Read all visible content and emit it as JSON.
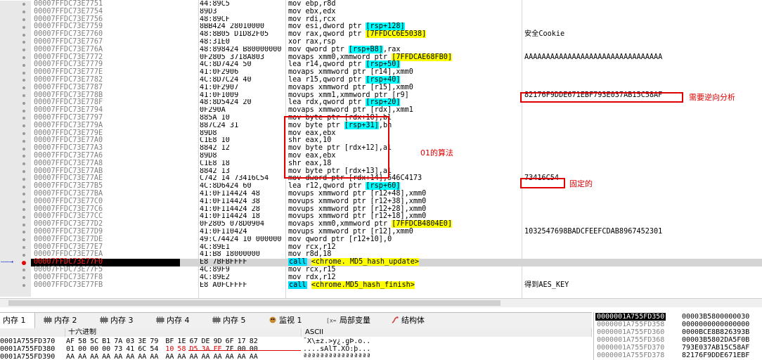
{
  "colors": {
    "accent_red": "#e00000",
    "ptr_yellow": "#ffff00",
    "reg_cyan": "#00ffff",
    "call_cyan": "#00e0ff",
    "arrow_blue": "#1b2bd6"
  },
  "disasm_rows": [
    {
      "addr": "00007FFDC73E7751",
      "bytes": "44:89C5",
      "ins": [
        {
          "t": "mov ebp,r8d"
        }
      ],
      "comment": ""
    },
    {
      "addr": "00007FFDC73E7754",
      "bytes": "89D3",
      "ins": [
        {
          "t": "mov ebx,edx"
        }
      ],
      "comment": ""
    },
    {
      "addr": "00007FFDC73E7756",
      "bytes": "48:89CF",
      "ins": [
        {
          "t": "mov rdi,rcx"
        }
      ],
      "comment": ""
    },
    {
      "addr": "00007FFDC73E7759",
      "bytes": "8BB424 28010000",
      "ins": [
        {
          "t": "mov esi,dword ptr "
        },
        {
          "t": "[rsp+128]",
          "c": "cy"
        }
      ],
      "comment": ""
    },
    {
      "addr": "00007FFDC73E7760",
      "bytes": "48:8B05 D1D82F05",
      "ins": [
        {
          "t": "mov rax,qword ptr "
        },
        {
          "t": "[7FFDCC6E5038]",
          "c": "y"
        }
      ],
      "comment": "安全Cookie"
    },
    {
      "addr": "00007FFDC73E7767",
      "bytes": "48:31E0",
      "ins": [
        {
          "t": "xor rax,rsp"
        }
      ],
      "comment": ""
    },
    {
      "addr": "00007FFDC73E776A",
      "bytes": "48:898424 B80000000",
      "ins": [
        {
          "t": "mov qword ptr "
        },
        {
          "t": "[rsp+B8]",
          "c": "cy"
        },
        {
          "t": ",rax"
        }
      ],
      "comment": ""
    },
    {
      "addr": "00007FFDC73E7772",
      "bytes": "0F2805 3718A803",
      "ins": [
        {
          "t": "movaps xmm0,xmmword ptr "
        },
        {
          "t": "[7FFDCAE68FB0]",
          "c": "y"
        }
      ],
      "comment": "AAAAAAAAAAAAAAAAAAAAAAAAAAAAAAAA"
    },
    {
      "addr": "00007FFDC73E7779",
      "bytes": "4C:8D7424 50",
      "ins": [
        {
          "t": "lea r14,qword ptr "
        },
        {
          "t": "[rsp+50]",
          "c": "cy"
        }
      ],
      "comment": ""
    },
    {
      "addr": "00007FFDC73E777E",
      "bytes": "41:0F2906",
      "ins": [
        {
          "t": "movaps xmmword ptr [r14],xmm0"
        }
      ],
      "comment": ""
    },
    {
      "addr": "00007FFDC73E7782",
      "bytes": "4C:8D7C24 40",
      "ins": [
        {
          "t": "lea r15,qword ptr "
        },
        {
          "t": "[rsp+40]",
          "c": "cy"
        }
      ],
      "comment": ""
    },
    {
      "addr": "00007FFDC73E7787",
      "bytes": "41:0F2907",
      "ins": [
        {
          "t": "movaps xmmword ptr [r15],xmm0"
        }
      ],
      "comment": ""
    },
    {
      "addr": "00007FFDC73E778B",
      "bytes": "41:0F1009",
      "ins": [
        {
          "t": "movups xmm1,xmmword ptr [r9]"
        }
      ],
      "comment": "82176F9DDE671EBF793E037AB15C58AF"
    },
    {
      "addr": "00007FFDC73E778F",
      "bytes": "48:8D5424 20",
      "ins": [
        {
          "t": "lea rdx,qword ptr "
        },
        {
          "t": "[rsp+20]",
          "c": "cy"
        }
      ],
      "comment": ""
    },
    {
      "addr": "00007FFDC73E7794",
      "bytes": "0F290A",
      "ins": [
        {
          "t": "movaps xmmword ptr [rdx],xmm1"
        }
      ],
      "comment": ""
    },
    {
      "addr": "00007FFDC73E7797",
      "bytes": "885A 10",
      "ins": [
        {
          "t": "mov byte ptr [rdx+10],bl"
        }
      ],
      "comment": ""
    },
    {
      "addr": "00007FFDC73E779A",
      "bytes": "887C24 31",
      "ins": [
        {
          "t": "mov byte ptr "
        },
        {
          "t": "[rsp+31]",
          "c": "cy"
        },
        {
          "t": ",bh"
        }
      ],
      "comment": ""
    },
    {
      "addr": "00007FFDC73E779E",
      "bytes": "89D8",
      "ins": [
        {
          "t": "mov eax,ebx"
        }
      ],
      "comment": ""
    },
    {
      "addr": "00007FFDC73E77A0",
      "bytes": "C1E8 10",
      "ins": [
        {
          "t": "shr eax,10"
        }
      ],
      "comment": ""
    },
    {
      "addr": "00007FFDC73E77A3",
      "bytes": "8842 12",
      "ins": [
        {
          "t": "mov byte ptr [rdx+12],al"
        }
      ],
      "comment": ""
    },
    {
      "addr": "00007FFDC73E77A6",
      "bytes": "89D8",
      "ins": [
        {
          "t": "mov eax,ebx"
        }
      ],
      "comment": ""
    },
    {
      "addr": "00007FFDC73E77A8",
      "bytes": "C1E8 18",
      "ins": [
        {
          "t": "shr eax,18"
        }
      ],
      "comment": ""
    },
    {
      "addr": "00007FFDC73E77AB",
      "bytes": "8842 13",
      "ins": [
        {
          "t": "mov byte ptr [rdx+13],al"
        }
      ],
      "comment": ""
    },
    {
      "addr": "00007FFDC73E77AE",
      "bytes": "C742 14 73416C54",
      "ins": [
        {
          "t": "mov dword ptr [rdx+14],546C4173"
        }
      ],
      "comment": "73416C54"
    },
    {
      "addr": "00007FFDC73E77B5",
      "bytes": "4C:8D6424 60",
      "ins": [
        {
          "t": "lea r12,qword ptr "
        },
        {
          "t": "[rsp+60]",
          "c": "cy"
        }
      ],
      "comment": ""
    },
    {
      "addr": "00007FFDC73E77BA",
      "bytes": "41:0F114424 48",
      "ins": [
        {
          "t": "movups xmmword ptr [r12+48],xmm0"
        }
      ],
      "comment": ""
    },
    {
      "addr": "00007FFDC73E77C0",
      "bytes": "41:0F114424 38",
      "ins": [
        {
          "t": "movups xmmword ptr [r12+38],xmm0"
        }
      ],
      "comment": ""
    },
    {
      "addr": "00007FFDC73E77C6",
      "bytes": "41:0F114424 28",
      "ins": [
        {
          "t": "movups xmmword ptr [r12+28],xmm0"
        }
      ],
      "comment": ""
    },
    {
      "addr": "00007FFDC73E77CC",
      "bytes": "41:0F114424 18",
      "ins": [
        {
          "t": "movups xmmword ptr [r12+18],xmm0"
        }
      ],
      "comment": ""
    },
    {
      "addr": "00007FFDC73E77D2",
      "bytes": "0F2805 078D0904",
      "ins": [
        {
          "t": "movaps xmm0,xmmword ptr "
        },
        {
          "t": "[7FFDCB4804E0]",
          "c": "y"
        }
      ],
      "comment": ""
    },
    {
      "addr": "00007FFDC73E77D9",
      "bytes": "41:0F110424",
      "ins": [
        {
          "t": "movups xmmword ptr [r12],xmm0"
        }
      ],
      "comment": "1032547698BADCFEEFCDAB8967452301"
    },
    {
      "addr": "00007FFDC73E77DE",
      "bytes": "49:C74424 10 000000",
      "ins": [
        {
          "t": "mov qword ptr [r12+10],0"
        }
      ],
      "comment": ""
    },
    {
      "addr": "00007FFDC73E77E7",
      "bytes": "4C:89E1",
      "ins": [
        {
          "t": "mov rcx,r12"
        }
      ],
      "comment": ""
    },
    {
      "addr": "00007FFDC73E77EA",
      "bytes": "41:B8 18000000",
      "ins": [
        {
          "t": "mov r8d,18"
        }
      ],
      "comment": ""
    },
    {
      "addr": "00007FFDC73E77F0",
      "bytes": "E8 7BFBFFFF",
      "ins": [
        {
          "t": "call",
          "c": "call"
        },
        {
          "t": " "
        },
        {
          "t": "<chrome. MD5_hash_update>",
          "c": "y"
        }
      ],
      "comment": "",
      "bp": true,
      "current": true
    },
    {
      "addr": "00007FFDC73E77F5",
      "bytes": "4C:89F9",
      "ins": [
        {
          "t": "mov rcx,r15"
        }
      ],
      "comment": ""
    },
    {
      "addr": "00007FFDC73E77F8",
      "bytes": "4C:89E2",
      "ins": [
        {
          "t": "mov rdx,r12"
        }
      ],
      "comment": ""
    },
    {
      "addr": "00007FFDC73E77FB",
      "bytes": "E8 A0FCFFFF",
      "ins": [
        {
          "t": "call",
          "c": "call"
        },
        {
          "t": " "
        },
        {
          "t": "<chrome.MD5_hash_finish>",
          "c": "y"
        }
      ],
      "comment": "得到AES_KEY"
    },
    {
      "addr": "",
      "bytes": "",
      "ins": [],
      "comment": ""
    }
  ],
  "annotations": {
    "reverse_note": "需要逆向分析",
    "algo_note": "01的算法",
    "fixed_note": "固定的"
  },
  "tabs": [
    {
      "label": "内存 1",
      "icon": "memory-icon"
    },
    {
      "label": "内存 2",
      "icon": "memory-icon"
    },
    {
      "label": "内存 3",
      "icon": "memory-icon"
    },
    {
      "label": "内存 4",
      "icon": "memory-icon"
    },
    {
      "label": "内存 5",
      "icon": "memory-icon"
    },
    {
      "label": "监视 1",
      "icon": "watch-icon"
    },
    {
      "label": "局部变量",
      "icon": "locals-icon"
    },
    {
      "label": "结构体",
      "icon": "struct-icon"
    }
  ],
  "dump": {
    "col_hex": "十六进制",
    "col_ascii": "ASCII",
    "rows": [
      {
        "addr": "0001A755FD370",
        "hex": [
          "AF",
          "58",
          "5C",
          "B1",
          "7A",
          "03",
          "3E",
          "79",
          "BF",
          "1E",
          "67",
          "DE",
          "9D",
          "6F",
          "17",
          "82"
        ],
        "ascii": "¯X\\±z.>y¿.gÞ.o.."
      },
      {
        "addr": "0001A755FD380",
        "hex": [
          "01",
          "00",
          "00",
          "00",
          "73",
          "41",
          "6C",
          "54",
          "10",
          "58",
          "D5",
          "3A",
          "FE",
          "7F",
          "00",
          "00"
        ],
        "ascii": "....sAlT.XÕ:þ..."
      },
      {
        "addr": "0001A755FD390",
        "hex": [
          "AA",
          "AA",
          "AA",
          "AA",
          "AA",
          "AA",
          "AA",
          "AA",
          "AA",
          "AA",
          "AA",
          "AA",
          "AA",
          "AA",
          "AA",
          "AA"
        ],
        "ascii": "ªªªªªªªªªªªªªªªª"
      }
    ]
  },
  "stack_rows": [
    {
      "addr": "0000001A755FD350",
      "val": "00003B5800000030",
      "sel": true
    },
    {
      "addr": "0000001A755FD358",
      "val": "0000000000000000"
    },
    {
      "addr": "0000001A755FD360",
      "val": "0000BCE8B826393B"
    },
    {
      "addr": "0000001A755FD368",
      "val": "00003B5802DA5F0B"
    },
    {
      "addr": "0000001A755FD370",
      "val": "793E037AB15C58AF"
    },
    {
      "addr": "0000001A755FD378",
      "val": "82176F9DDE671EBF"
    }
  ]
}
